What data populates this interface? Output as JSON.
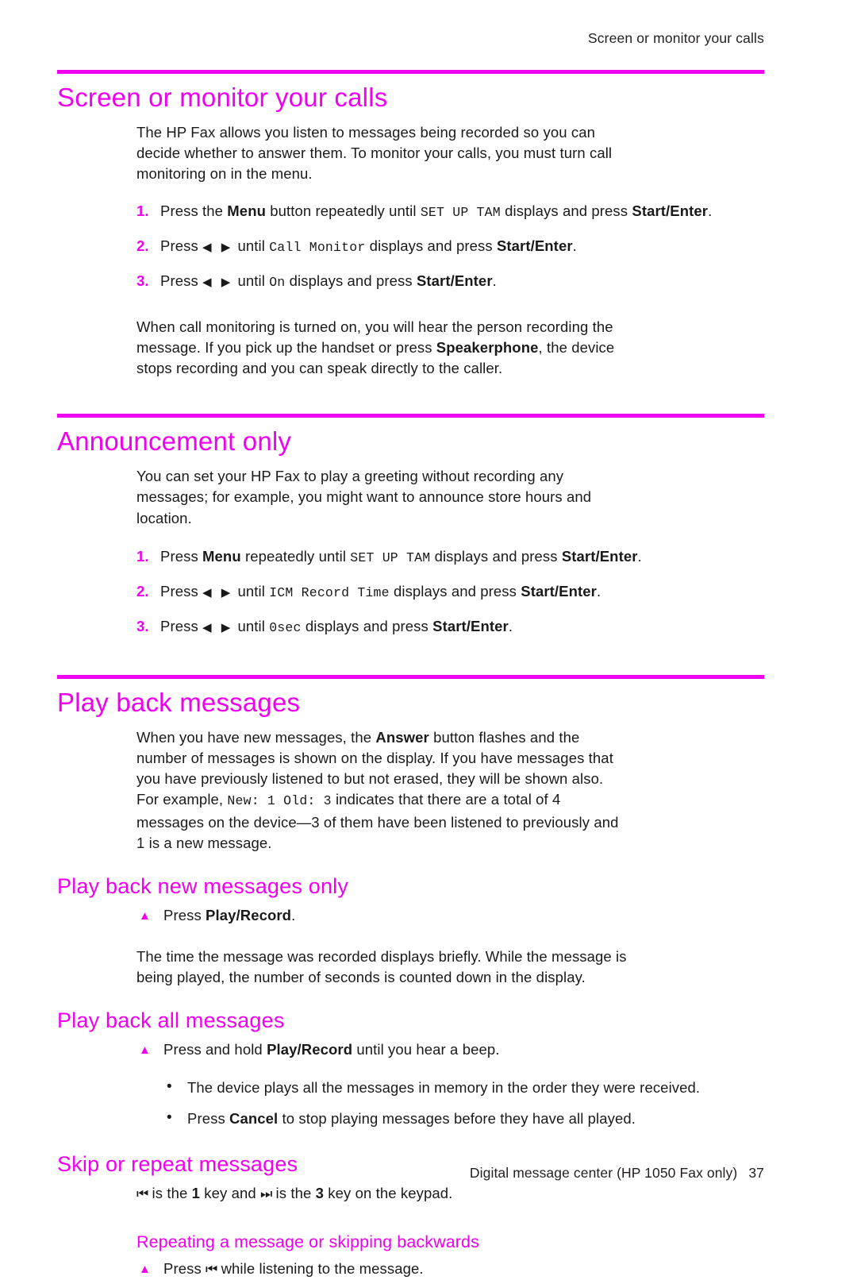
{
  "running_head": "Screen or monitor your calls",
  "accent_color": "#F000F0",
  "text_color": "#1A1A1A",
  "sections": [
    {
      "id": "screen-or-monitor-your-calls",
      "heading": "Screen or monitor your calls",
      "intro": "The HP Fax allows you listen to messages being recorded so you can decide whether to answer them. To monitor your calls, you must turn call monitoring on in the menu.",
      "steps": [
        {
          "num": "1.",
          "pre": "Press the ",
          "bold1": "Menu",
          "mid1": " button repeatedly until ",
          "mono1": "SET UP TAM",
          "mid2": " displays and press ",
          "bold2": "Start/Enter",
          "post": "."
        },
        {
          "num": "2.",
          "pre": "Press ",
          "arrows": "◀  ▶",
          "mid1": " until ",
          "mono1": "Call Monitor",
          "mid2": " displays and press ",
          "bold2": "Start/Enter",
          "post": "."
        },
        {
          "num": "3.",
          "pre": "Press ",
          "arrows": "◀  ▶",
          "mid1": " until ",
          "mono1": "On",
          "mid2": " displays and press ",
          "bold2": "Start/Enter",
          "post": "."
        }
      ],
      "outro_pre": "When call monitoring is turned on, you will hear the person recording the message. If you pick up the handset or press ",
      "outro_bold": "Speakerphone",
      "outro_post": ", the device stops recording and you can speak directly to the caller."
    },
    {
      "id": "announcement-only",
      "heading": "Announcement only",
      "intro": "You can set your HP Fax to play a greeting without recording any messages; for example, you might want to announce store hours and location.",
      "steps": [
        {
          "num": "1.",
          "pre": "Press ",
          "bold1": "Menu",
          "mid1": " repeatedly until ",
          "mono1": "SET UP TAM",
          "mid2": " displays and press ",
          "bold2": "Start/Enter",
          "post": "."
        },
        {
          "num": "2.",
          "pre": "Press ",
          "arrows": "◀  ▶",
          "mid1": " until ",
          "mono1": "ICM Record Time",
          "mid2": " displays and press ",
          "bold2": "Start/Enter",
          "post": "."
        },
        {
          "num": "3.",
          "pre": "Press ",
          "arrows": "◀  ▶",
          "mid1": " until ",
          "mono1": "0sec",
          "mid2": " displays and press ",
          "bold2": "Start/Enter",
          "post": "."
        }
      ]
    }
  ],
  "playback": {
    "heading": "Play back messages",
    "intro_a": "When you have new messages, the ",
    "intro_bold": "Answer",
    "intro_b": " button flashes and the number of messages is shown on the display. If you have messages that you have previously listened to but not erased, they will be shown also. For example, ",
    "intro_mono": "New: 1 Old: 3",
    "intro_c": " indicates that there are a total of 4 messages on the device—3 of them have been listened to previously and 1 is a new message.",
    "sub_new": {
      "heading": "Play back new messages only",
      "step_pre": "Press ",
      "step_bold": "Play/Record",
      "step_post": ".",
      "note": "The time the message was recorded displays briefly. While the message is being played, the number of seconds is counted down in the display."
    },
    "sub_all": {
      "heading": "Play back all messages",
      "step_pre": "Press and hold ",
      "step_bold": "Play/Record",
      "step_post": " until you hear a beep.",
      "bullets": [
        {
          "pre": "The device plays all the messages in memory in the order they were received.",
          "bold": "",
          "post": ""
        },
        {
          "pre": "Press ",
          "bold": "Cancel",
          "post": " to stop playing messages before they have all played."
        }
      ]
    },
    "sub_skip": {
      "heading": "Skip or repeat messages",
      "line_icon_back": "⏮",
      "line_a": " is the ",
      "key_1": "1",
      "line_b": " key and ",
      "line_icon_fwd": "⏭",
      "line_c": " is the ",
      "key_3": "3",
      "line_d": " key on the keypad.",
      "sub_sub_heading": "Repeating a message or skipping backwards",
      "step_pre": "Press ",
      "step_icon": "⏮",
      "step_post": " while listening to the message."
    }
  },
  "footer": {
    "text": "Digital message center (HP 1050 Fax only)",
    "page": "37"
  },
  "icons": {
    "triangle_bullet": "▲",
    "round_bullet": "•",
    "arrow_left": "◀",
    "arrow_right": "▶",
    "skip_back": "skip-back-icon",
    "skip_forward": "skip-forward-icon"
  }
}
